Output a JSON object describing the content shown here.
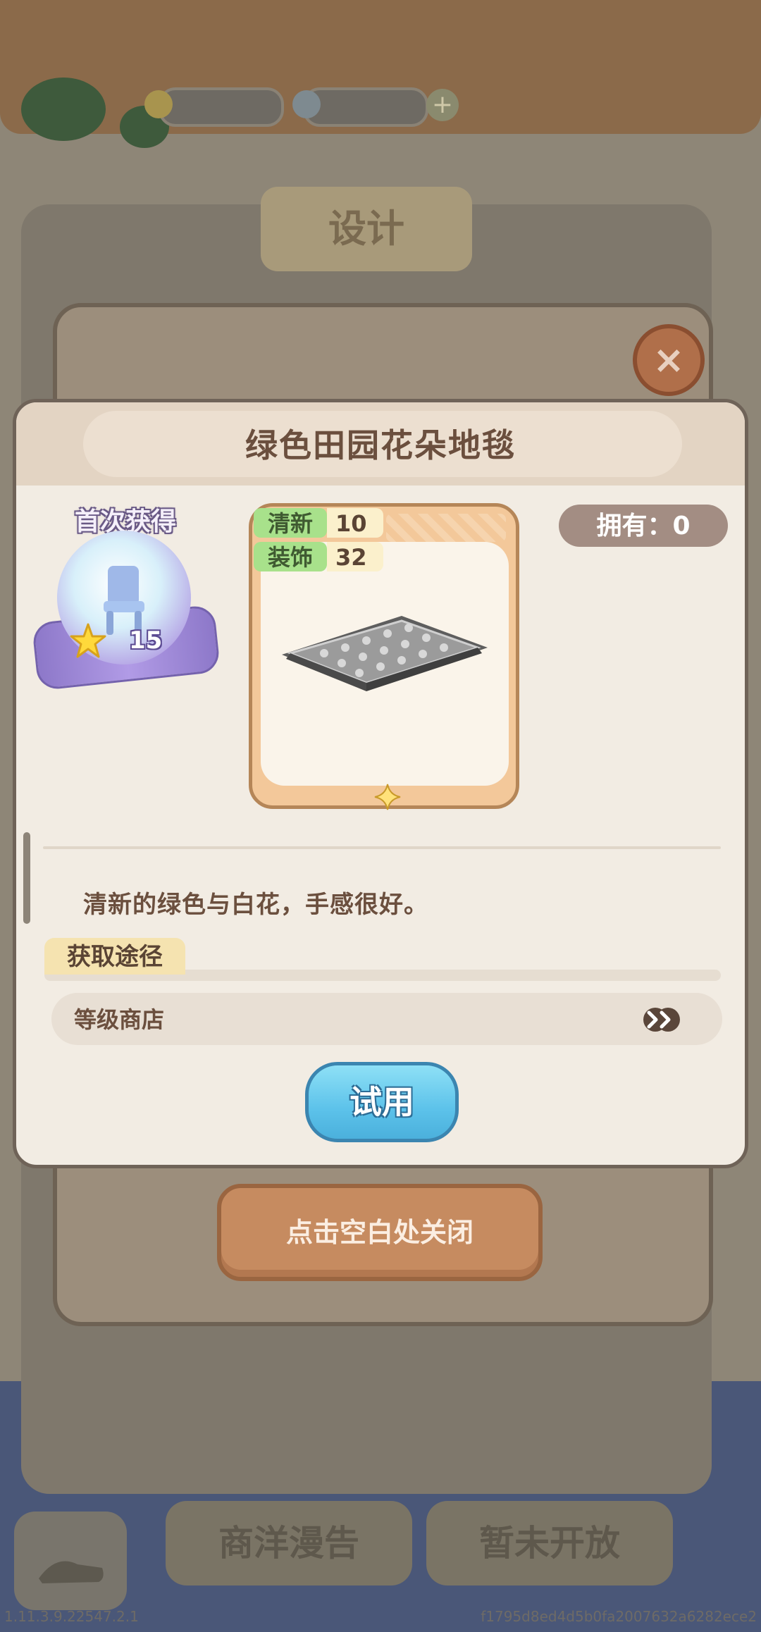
{
  "background": {
    "design_tab": "设计",
    "bottom_tabs": [
      "商洋漫告",
      "暂未开放"
    ],
    "close_glyph": "×",
    "plus_glyph": "+"
  },
  "popup": {
    "title": "绿色田园花朵地毯",
    "first_acquire": {
      "label": "首次获得",
      "reward_count": "15"
    },
    "owned": "拥有：0",
    "stats": [
      {
        "key": "清新",
        "value": "10"
      },
      {
        "key": "装饰",
        "value": "32"
      }
    ],
    "description": "清新的绿色与白花，手感很好。",
    "source": {
      "tab_label": "获取途径",
      "entry": "等级商店"
    },
    "try_button": "试用"
  },
  "close_hint": "点击空白处关闭",
  "footer": {
    "version": "1.11.3.9.22547.2.1",
    "hash": "f1795d8ed4d5b0fa2007632a6282ece2"
  },
  "colors": {
    "popup_bg": "#f2ece3",
    "title": "#6b4f3e",
    "try_button": "#5cc2ea",
    "stat_key": "#a8e18b",
    "close_hint": "#c68b60"
  }
}
